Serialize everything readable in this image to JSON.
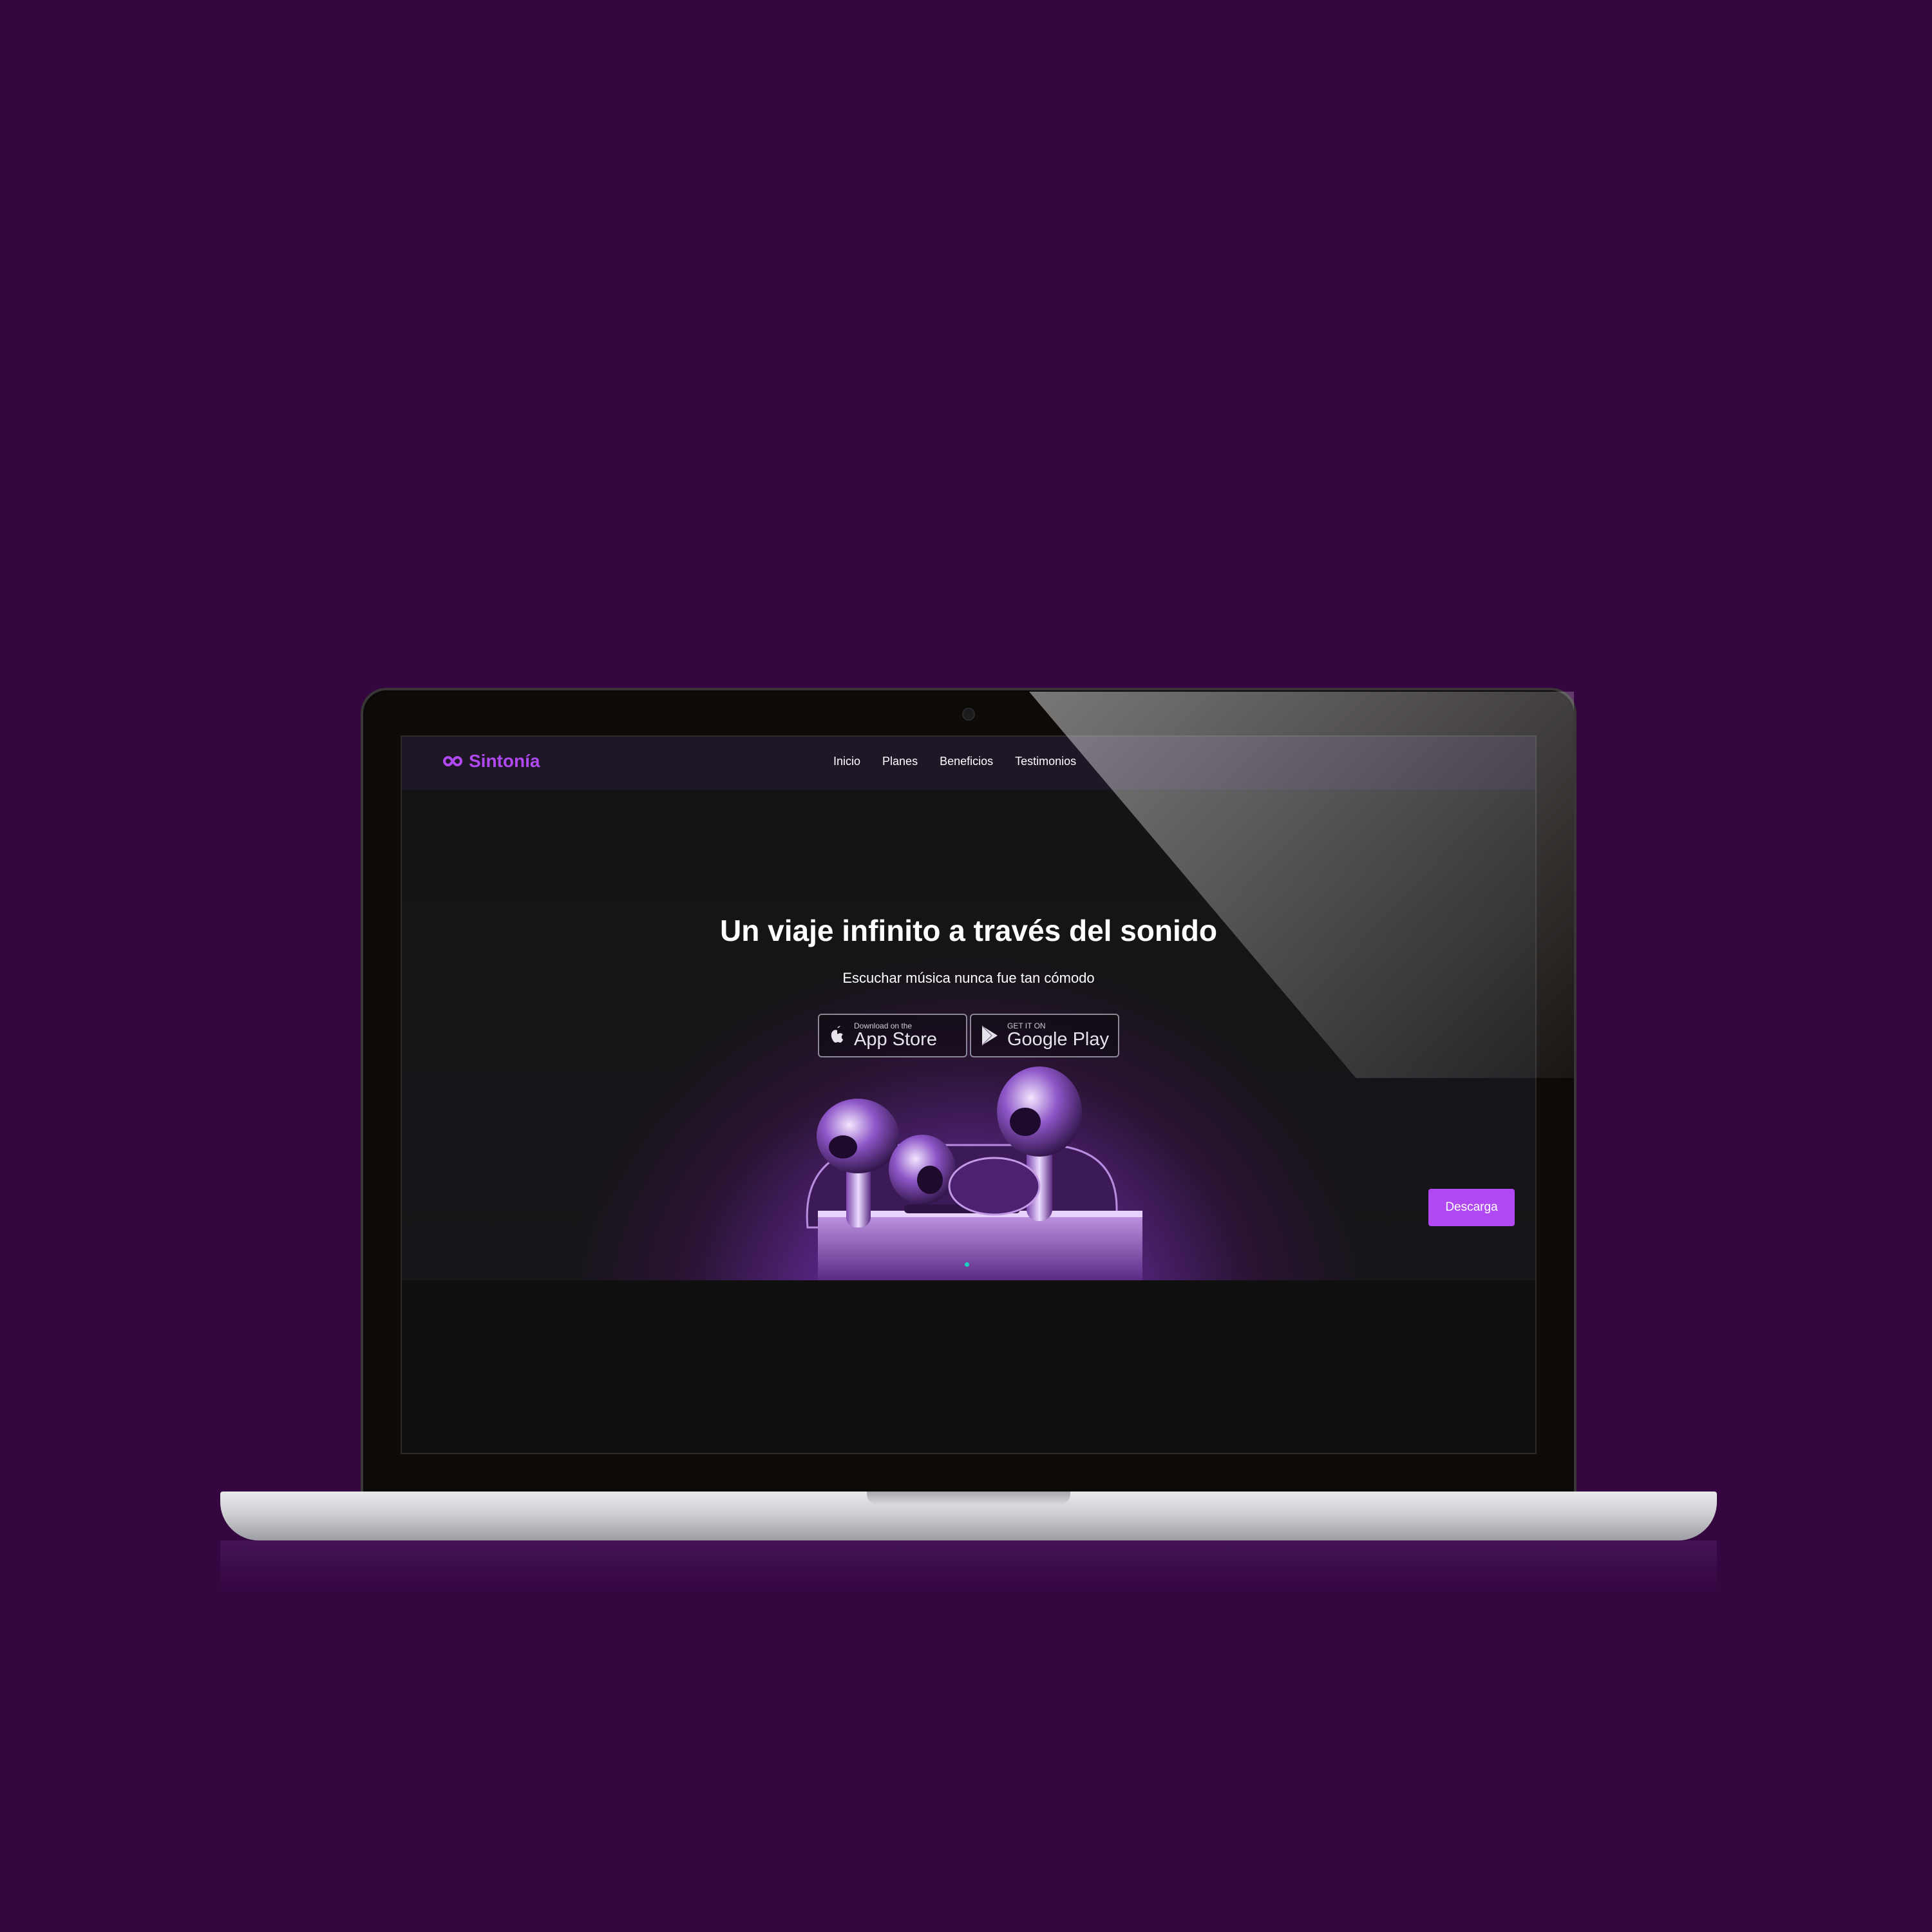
{
  "brand": {
    "name": "Sintonía",
    "color": "#b149f3",
    "logo_icon": "infinity-icon"
  },
  "nav": {
    "items": [
      "Inicio",
      "Planes",
      "Beneficios",
      "Testimonios"
    ]
  },
  "hero": {
    "title": "Un viaje infinito a través del sonido",
    "subtitle": "Escuchar música nunca fue tan cómodo",
    "app_store": {
      "small": "Download on the",
      "big": "App Store",
      "icon": "apple-icon"
    },
    "google_play": {
      "small": "GET IT ON",
      "big": "Google Play",
      "icon": "play-triangle-icon"
    },
    "product_image": "airpods-pro-case"
  },
  "cta": {
    "label": "Descarga"
  },
  "colors": {
    "background": "#360641",
    "accent": "#b149f3",
    "navbar": "#1f1626",
    "dot": "#1ad0c0"
  }
}
